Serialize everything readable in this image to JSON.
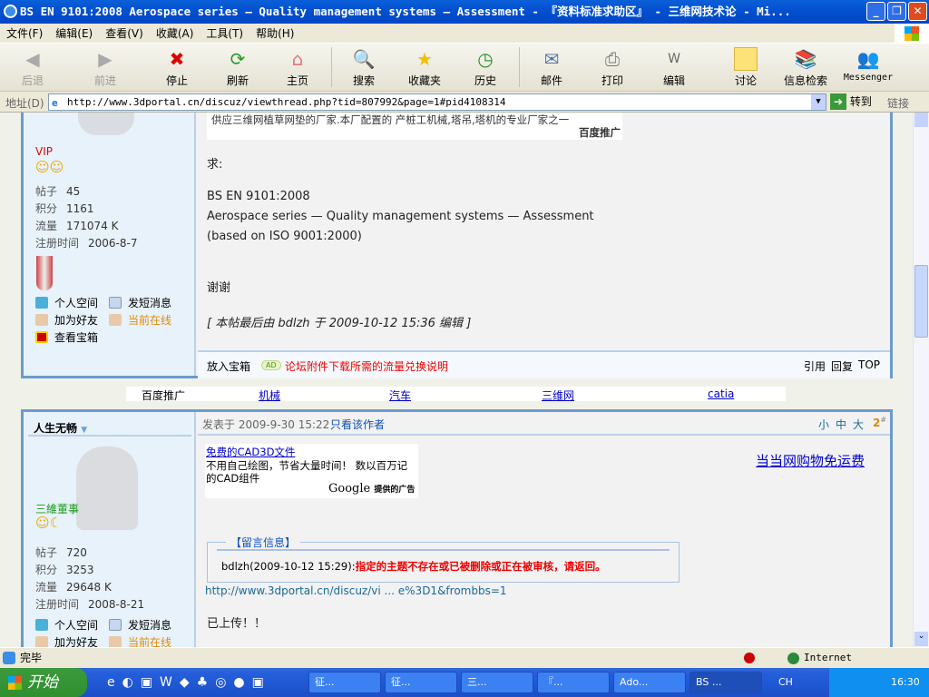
{
  "window": {
    "title": "BS EN 9101:2008 Aerospace series — Quality management systems — Assessment - 『资料标准求助区』 - 三维网技术论 - Mi...",
    "min": "_",
    "max": "❐",
    "close": "✕"
  },
  "menu": [
    "文件(F)",
    "编辑(E)",
    "查看(V)",
    "收藏(A)",
    "工具(T)",
    "帮助(H)"
  ],
  "toolbar": {
    "back": "后退",
    "forward": "前进",
    "stop": "停止",
    "refresh": "刷新",
    "home": "主页",
    "search": "搜索",
    "favorites": "收藏夹",
    "history": "历史",
    "mail": "邮件",
    "print": "打印",
    "edit": "编辑",
    "discuss": "讨论",
    "research": "信息检索",
    "messenger": "Messenger"
  },
  "address": {
    "label": "地址(D)",
    "url": "http://www.3dportal.cn/discuz/viewthread.php?tid=807992&page=1#pid4108314",
    "go": "转到",
    "links": "链接"
  },
  "post1": {
    "rank": "VIP",
    "stats": [
      {
        "k": "帖子",
        "v": "45"
      },
      {
        "k": "积分",
        "v": "1161"
      },
      {
        "k": "流量",
        "v": "171074 K"
      },
      {
        "k": "注册时间",
        "v": "2006-8-7"
      }
    ],
    "links": {
      "space": "个人空间",
      "pm": "发短消息",
      "friend": "加为好友",
      "online": "当前在线",
      "box": "查看宝箱"
    },
    "ad_text": "供应三维网植草网垫的厂家.本厂配置的      产桩工机械,塔吊,塔机的专业厂家之一",
    "ad_brand": "百度推广",
    "body": [
      "求:",
      "BS EN 9101:2008",
      "Aerospace series — Quality management systems — Assessment",
      "(based on ISO 9001:2000)",
      "谢谢"
    ],
    "edit_note": "[ 本帖最后由  bdlzh  于  2009-10-12 15:36 编辑 ]",
    "footer": {
      "treasure": "放入宝箱",
      "ad_badge": "AD",
      "ad_link": "论坛附件下载所需的流量兑换说明",
      "quote": "引用",
      "reply": "回复",
      "top": "TOP"
    }
  },
  "adbar": {
    "label": "百度推广",
    "links": [
      "机械",
      "汽车",
      "三维网",
      "catia"
    ]
  },
  "post2": {
    "author": "人生无畅",
    "meta": "发表于  2009-9-30 15:22",
    "only_author": "只看该作者",
    "sizes": [
      "小",
      "中",
      "大"
    ],
    "floor": "2",
    "floor_sup": "#",
    "rank": "三維董事",
    "stats": [
      {
        "k": "帖子",
        "v": "720"
      },
      {
        "k": "积分",
        "v": "3253"
      },
      {
        "k": "流量",
        "v": "29648 K"
      },
      {
        "k": "注册时间",
        "v": "2008-8-21"
      }
    ],
    "links": {
      "space": "个人空间",
      "pm": "发短消息",
      "friend": "加为好友",
      "online": "当前在线"
    },
    "gad": {
      "title": "免费的CAD3D文件",
      "text": "不用自己绘图，节省大量时间！ 数以百万记的CAD组件",
      "brand": "Google",
      "brand_suffix": "提供的广告"
    },
    "dangdang": "当当网购物免运费",
    "msg_title": "【留言信息】",
    "msg_user": "bdlzh(2009-10-12 15:29):",
    "msg_text": "指定的主题不存在或已被删除或正在被审核，请返回。",
    "url": "http://www.3dportal.cn/discuz/vi ... e%3D1&frombbs=1",
    "uploaded": "已上传！！"
  },
  "status": {
    "text": "完毕",
    "zone": "Internet"
  },
  "taskbar": {
    "start": "开始",
    "tasks": [
      "征...",
      "征...",
      "三...",
      "『...",
      "Ado...",
      "BS ..."
    ],
    "lang": "CH",
    "clock": "16:30"
  }
}
